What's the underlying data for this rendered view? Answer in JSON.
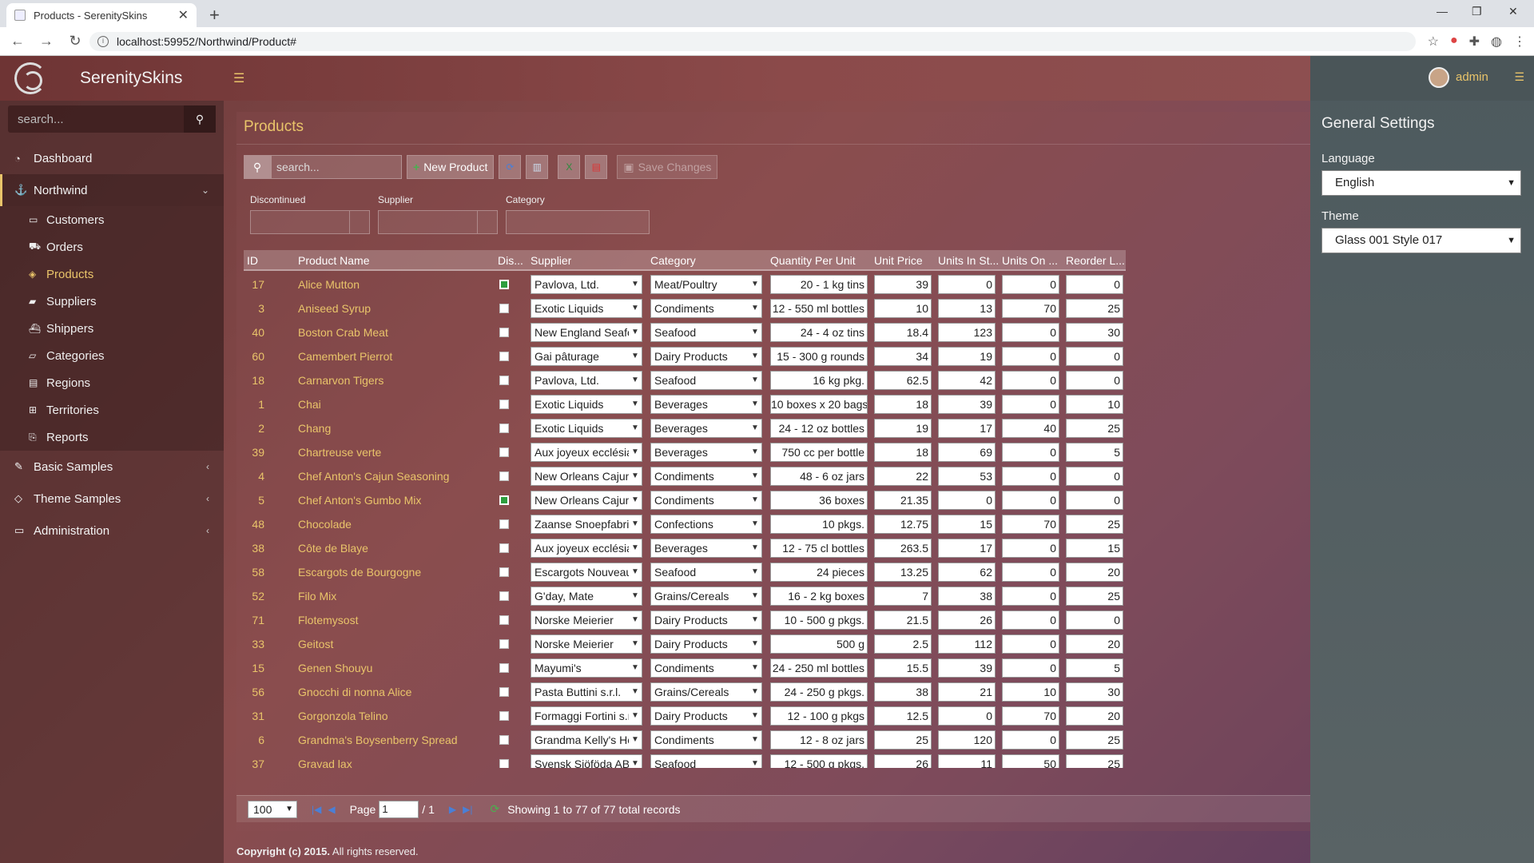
{
  "browser": {
    "tab_title": "Products - SerenitySkins",
    "url": "localhost:59952/Northwind/Product#"
  },
  "app": {
    "brand": "SerenitySkins"
  },
  "sidebar": {
    "search_placeholder": "search...",
    "items": [
      {
        "label": "Dashboard",
        "icon": "dashboard-icon"
      },
      {
        "label": "Northwind",
        "icon": "anchor-icon"
      },
      {
        "label": "Basic Samples",
        "icon": "magic-icon"
      },
      {
        "label": "Theme Samples",
        "icon": "diamond-icon"
      },
      {
        "label": "Administration",
        "icon": "desktop-icon"
      }
    ],
    "sub_items": [
      {
        "label": "Customers",
        "icon": "credit-card-icon"
      },
      {
        "label": "Orders",
        "icon": "cart-icon"
      },
      {
        "label": "Products",
        "icon": "cube-icon"
      },
      {
        "label": "Suppliers",
        "icon": "truck-icon"
      },
      {
        "label": "Shippers",
        "icon": "ship-icon"
      },
      {
        "label": "Categories",
        "icon": "folder-icon"
      },
      {
        "label": "Regions",
        "icon": "map-icon"
      },
      {
        "label": "Territories",
        "icon": "sitemap-icon"
      },
      {
        "label": "Reports",
        "icon": "report-icon"
      }
    ]
  },
  "page": {
    "title": "Products",
    "search_placeholder": "search...",
    "new_button": "New Product",
    "save_button": "Save Changes"
  },
  "filters": {
    "discontinued": "Discontinued",
    "supplier": "Supplier",
    "category": "Category"
  },
  "grid": {
    "columns": [
      "ID",
      "Product Name",
      "Dis...",
      "Supplier",
      "Category",
      "Quantity Per Unit",
      "Unit Price",
      "Units In St...",
      "Units On ...",
      "Reorder L..."
    ],
    "rows": [
      {
        "id": "17",
        "name": "Alice Mutton",
        "disc": true,
        "supplier": "Pavlova, Ltd.",
        "category": "Meat/Poultry",
        "qty": "20 - 1 kg tins",
        "price": "39",
        "stock": "0",
        "order": "0",
        "reorder": "0"
      },
      {
        "id": "3",
        "name": "Aniseed Syrup",
        "disc": false,
        "supplier": "Exotic Liquids",
        "category": "Condiments",
        "qty": "12 - 550 ml bottles",
        "price": "10",
        "stock": "13",
        "order": "70",
        "reorder": "25"
      },
      {
        "id": "40",
        "name": "Boston Crab Meat",
        "disc": false,
        "supplier": "New England Seafo",
        "category": "Seafood",
        "qty": "24 - 4 oz tins",
        "price": "18.4",
        "stock": "123",
        "order": "0",
        "reorder": "30"
      },
      {
        "id": "60",
        "name": "Camembert Pierrot",
        "disc": false,
        "supplier": "Gai pâturage",
        "category": "Dairy Products",
        "qty": "15 - 300 g rounds",
        "price": "34",
        "stock": "19",
        "order": "0",
        "reorder": "0"
      },
      {
        "id": "18",
        "name": "Carnarvon Tigers",
        "disc": false,
        "supplier": "Pavlova, Ltd.",
        "category": "Seafood",
        "qty": "16 kg pkg.",
        "price": "62.5",
        "stock": "42",
        "order": "0",
        "reorder": "0"
      },
      {
        "id": "1",
        "name": "Chai",
        "disc": false,
        "supplier": "Exotic Liquids",
        "category": "Beverages",
        "qty": "10 boxes x 20 bags",
        "price": "18",
        "stock": "39",
        "order": "0",
        "reorder": "10"
      },
      {
        "id": "2",
        "name": "Chang",
        "disc": false,
        "supplier": "Exotic Liquids",
        "category": "Beverages",
        "qty": "24 - 12 oz bottles",
        "price": "19",
        "stock": "17",
        "order": "40",
        "reorder": "25"
      },
      {
        "id": "39",
        "name": "Chartreuse verte",
        "disc": false,
        "supplier": "Aux joyeux ecclésia",
        "category": "Beverages",
        "qty": "750 cc per bottle",
        "price": "18",
        "stock": "69",
        "order": "0",
        "reorder": "5"
      },
      {
        "id": "4",
        "name": "Chef Anton's Cajun Seasoning",
        "disc": false,
        "supplier": "New Orleans Cajun",
        "category": "Condiments",
        "qty": "48 - 6 oz jars",
        "price": "22",
        "stock": "53",
        "order": "0",
        "reorder": "0"
      },
      {
        "id": "5",
        "name": "Chef Anton's Gumbo Mix",
        "disc": true,
        "supplier": "New Orleans Cajun",
        "category": "Condiments",
        "qty": "36 boxes",
        "price": "21.35",
        "stock": "0",
        "order": "0",
        "reorder": "0"
      },
      {
        "id": "48",
        "name": "Chocolade",
        "disc": false,
        "supplier": "Zaanse Snoepfabrie",
        "category": "Confections",
        "qty": "10 pkgs.",
        "price": "12.75",
        "stock": "15",
        "order": "70",
        "reorder": "25"
      },
      {
        "id": "38",
        "name": "Côte de Blaye",
        "disc": false,
        "supplier": "Aux joyeux ecclésia",
        "category": "Beverages",
        "qty": "12 - 75 cl bottles",
        "price": "263.5",
        "stock": "17",
        "order": "0",
        "reorder": "15"
      },
      {
        "id": "58",
        "name": "Escargots de Bourgogne",
        "disc": false,
        "supplier": "Escargots Nouveau",
        "category": "Seafood",
        "qty": "24 pieces",
        "price": "13.25",
        "stock": "62",
        "order": "0",
        "reorder": "20"
      },
      {
        "id": "52",
        "name": "Filo Mix",
        "disc": false,
        "supplier": "G'day, Mate",
        "category": "Grains/Cereals",
        "qty": "16 - 2 kg boxes",
        "price": "7",
        "stock": "38",
        "order": "0",
        "reorder": "25"
      },
      {
        "id": "71",
        "name": "Flotemysost",
        "disc": false,
        "supplier": "Norske Meierier",
        "category": "Dairy Products",
        "qty": "10 - 500 g pkgs.",
        "price": "21.5",
        "stock": "26",
        "order": "0",
        "reorder": "0"
      },
      {
        "id": "33",
        "name": "Geitost",
        "disc": false,
        "supplier": "Norske Meierier",
        "category": "Dairy Products",
        "qty": "500 g",
        "price": "2.5",
        "stock": "112",
        "order": "0",
        "reorder": "20"
      },
      {
        "id": "15",
        "name": "Genen Shouyu",
        "disc": false,
        "supplier": "Mayumi's",
        "category": "Condiments",
        "qty": "24 - 250 ml bottles",
        "price": "15.5",
        "stock": "39",
        "order": "0",
        "reorder": "5"
      },
      {
        "id": "56",
        "name": "Gnocchi di nonna Alice",
        "disc": false,
        "supplier": "Pasta Buttini s.r.l.",
        "category": "Grains/Cereals",
        "qty": "24 - 250 g pkgs.",
        "price": "38",
        "stock": "21",
        "order": "10",
        "reorder": "30"
      },
      {
        "id": "31",
        "name": "Gorgonzola Telino",
        "disc": false,
        "supplier": "Formaggi Fortini s.r",
        "category": "Dairy Products",
        "qty": "12 - 100 g pkgs",
        "price": "12.5",
        "stock": "0",
        "order": "70",
        "reorder": "20"
      },
      {
        "id": "6",
        "name": "Grandma's Boysenberry Spread",
        "disc": false,
        "supplier": "Grandma Kelly's Ho",
        "category": "Condiments",
        "qty": "12 - 8 oz jars",
        "price": "25",
        "stock": "120",
        "order": "0",
        "reorder": "25"
      },
      {
        "id": "37",
        "name": "Gravad lax",
        "disc": false,
        "supplier": "Svensk Sjöföda AB",
        "category": "Seafood",
        "qty": "12 - 500 g pkgs.",
        "price": "26",
        "stock": "11",
        "order": "50",
        "reorder": "25"
      }
    ]
  },
  "pager": {
    "page_size": "100",
    "page_label": "Page",
    "page_value": "1",
    "page_total": "/ 1",
    "status": "Showing 1 to 77 of 77 total records"
  },
  "footer": {
    "copyright_bold": "Copyright (c) 2015.",
    "copyright_rest": " All rights reserved."
  },
  "settings": {
    "user": "admin",
    "title": "General Settings",
    "language_label": "Language",
    "language_value": "English",
    "theme_label": "Theme",
    "theme_value": "Glass 001 Style 017"
  }
}
